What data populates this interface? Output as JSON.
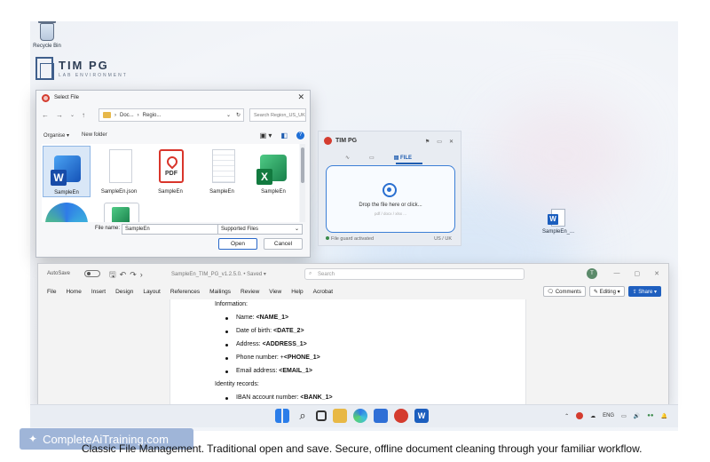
{
  "desktop": {
    "recycle_bin_label": "Recycle Bin",
    "logo_title": "TIM PG",
    "logo_subtitle": "LAB ENVIRONMENT",
    "desktop_file_label": "SampleEn_..."
  },
  "dialog": {
    "title": "Select File",
    "breadcrumb": [
      "Doc...",
      "Regio..."
    ],
    "search_placeholder": "Search Region_US_UK",
    "organise_label": "Organise ▾",
    "new_folder_label": "New folder",
    "files": [
      {
        "label": "SampleEn",
        "icon": "word-icon",
        "selected": true
      },
      {
        "label": "SampleEn.json",
        "icon": "json-file-icon",
        "selected": false
      },
      {
        "label": "SampleEn",
        "icon": "pdf-icon",
        "selected": false
      },
      {
        "label": "SampleEn",
        "icon": "text-file-icon",
        "selected": false
      },
      {
        "label": "SampleEn",
        "icon": "excel-icon",
        "selected": false
      }
    ],
    "file_name_label": "File name:",
    "file_name_value": "SampleEn",
    "file_type_value": "Supported Files",
    "open_label": "Open",
    "cancel_label": "Cancel"
  },
  "tim_panel": {
    "title": "TIM PG",
    "tab_file": "FILE",
    "drop_text": "Drop the file here or click...",
    "drop_subtext": "pdf / docx / xlsx ...",
    "status": "File guard activated",
    "region": "US / UK"
  },
  "word": {
    "autosave_label": "AutoSave",
    "doc_title": "SampleEn_TIM_PG_v1.2.5.0. • Saved ▾",
    "search_placeholder": "Search",
    "avatar_initial": "T",
    "menu": [
      "File",
      "Home",
      "Insert",
      "Design",
      "Layout",
      "References",
      "Mailings",
      "Review",
      "View",
      "Help",
      "Acrobat"
    ],
    "comments_label": "Comments",
    "editing_label": "Editing ▾",
    "share_label": "Share ▾",
    "content": {
      "information_heading": "Information:",
      "name_label": "Name: ",
      "name_tag": "<NAME_1>",
      "dob_label": "Date of birth: ",
      "dob_tag": "<DATE_2>",
      "address_label": "Address: ",
      "address_tag": "<ADDRESS_1>",
      "phone_label": "Phone number: +",
      "phone_tag": "<PHONE_1>",
      "email_label": "Email address: ",
      "email_tag": "<EMAIL_1>",
      "identity_heading": "Identity records:",
      "iban_label": "IBAN account number: ",
      "iban_tag": "<BANK_1>"
    }
  },
  "taskbar": {
    "lang": "ENG"
  },
  "caption": {
    "brand": "CompleteAiTraining.com",
    "text": "Classic File Management. Traditional open and save. Secure, offline document cleaning through your familiar workflow."
  }
}
